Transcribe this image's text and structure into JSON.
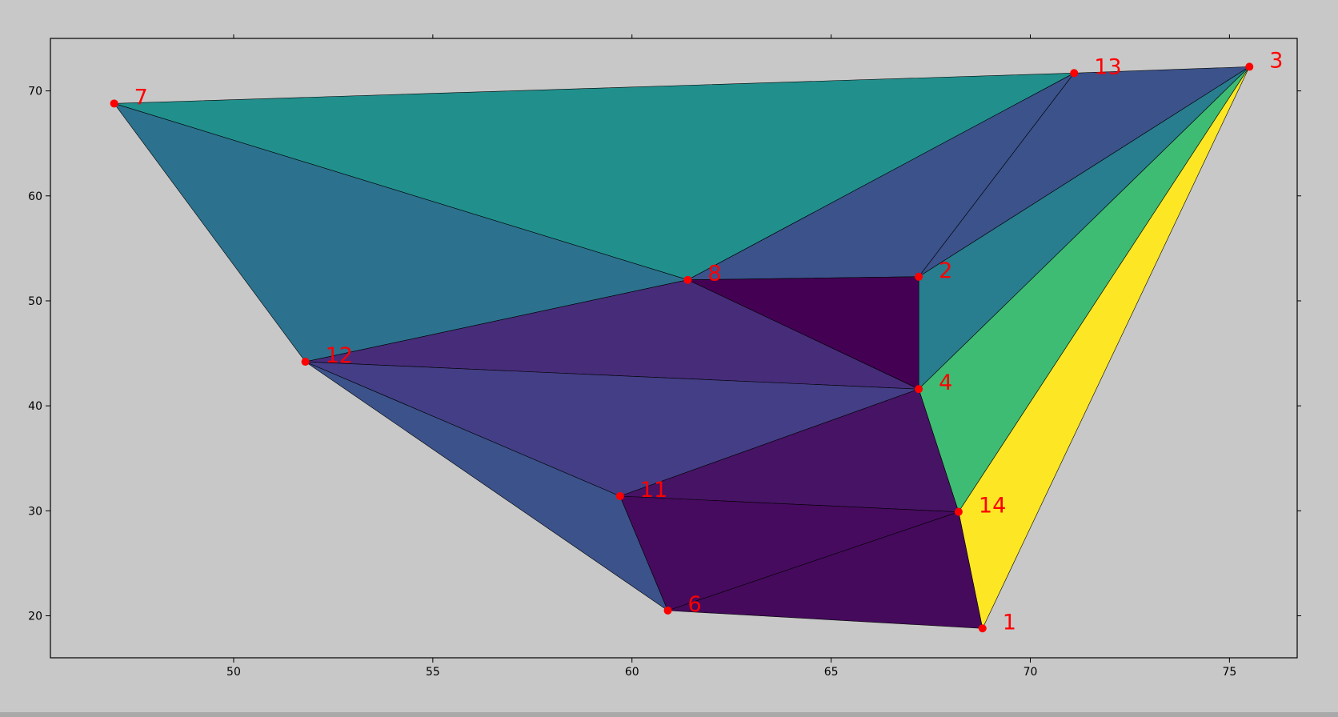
{
  "chart_data": {
    "type": "triangulation",
    "title": "",
    "xlabel": "",
    "ylabel": "",
    "xlim": [
      45.4,
      76.7
    ],
    "ylim": [
      16.0,
      75.0
    ],
    "xticks": [
      50,
      55,
      60,
      65,
      70,
      75
    ],
    "yticks": [
      20,
      30,
      40,
      50,
      60,
      70
    ],
    "grid": false,
    "background_color": "#c8c8c8",
    "edge_color": "#000000",
    "point_color": "#ff0000",
    "label_color": "#ff0000",
    "points": [
      {
        "label": "1",
        "x": 68.8,
        "y": 18.8
      },
      {
        "label": "2",
        "x": 67.2,
        "y": 52.3
      },
      {
        "label": "3",
        "x": 75.5,
        "y": 72.3
      },
      {
        "label": "4",
        "x": 67.2,
        "y": 41.6
      },
      {
        "label": "6",
        "x": 60.9,
        "y": 20.5
      },
      {
        "label": "7",
        "x": 47.0,
        "y": 68.8
      },
      {
        "label": "8",
        "x": 61.4,
        "y": 52.0
      },
      {
        "label": "11",
        "x": 59.7,
        "y": 31.4
      },
      {
        "label": "12",
        "x": 51.8,
        "y": 44.2
      },
      {
        "label": "13",
        "x": 71.1,
        "y": 71.7
      },
      {
        "label": "14",
        "x": 68.2,
        "y": 29.9
      }
    ],
    "triangles": [
      {
        "v": [
          "7",
          "13",
          "8"
        ],
        "color": "#21908d"
      },
      {
        "v": [
          "7",
          "8",
          "12"
        ],
        "color": "#2c728e"
      },
      {
        "v": [
          "8",
          "13",
          "2"
        ],
        "color": "#3b528b"
      },
      {
        "v": [
          "13",
          "3",
          "2"
        ],
        "color": "#3b528b"
      },
      {
        "v": [
          "2",
          "3",
          "4"
        ],
        "color": "#287d8e"
      },
      {
        "v": [
          "4",
          "3",
          "14"
        ],
        "color": "#3fbc73"
      },
      {
        "v": [
          "14",
          "3",
          "1"
        ],
        "color": "#fde725"
      },
      {
        "v": [
          "8",
          "2",
          "4"
        ],
        "color": "#440154"
      },
      {
        "v": [
          "12",
          "8",
          "4"
        ],
        "color": "#472c7a"
      },
      {
        "v": [
          "12",
          "4",
          "11"
        ],
        "color": "#433e85"
      },
      {
        "v": [
          "12",
          "11",
          "6"
        ],
        "color": "#3b528b"
      },
      {
        "v": [
          "11",
          "4",
          "14"
        ],
        "color": "#471365"
      },
      {
        "v": [
          "11",
          "14",
          "6"
        ],
        "color": "#460b5e"
      },
      {
        "v": [
          "6",
          "14",
          "1"
        ],
        "color": "#450a5c"
      }
    ]
  }
}
